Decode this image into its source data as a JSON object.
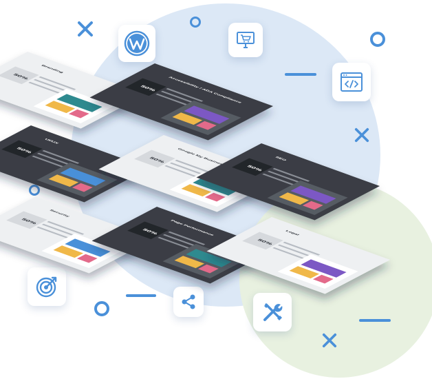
{
  "colors": {
    "accent": "#4a90d9",
    "blob_blue": "#dce8f6",
    "blob_green": "#e8f1e0",
    "dark_slide": "#3a3d44",
    "light_slide": "#eef0f2",
    "teal": "#2d8a8f"
  },
  "icons": [
    "wordpress-icon",
    "cart-monitor-icon",
    "code-window-icon",
    "target-icon",
    "share-icon",
    "tools-icon"
  ],
  "slides": [
    {
      "title": "Branding",
      "percent": "50%",
      "theme": "light"
    },
    {
      "title": "Accessibility / ADA Compliance",
      "percent": "50%",
      "theme": "dark"
    },
    {
      "title": "UI/UX",
      "percent": "50%",
      "theme": "dark"
    },
    {
      "title": "Google My Business (GMB)",
      "percent": "50%",
      "theme": "light"
    },
    {
      "title": "SEO",
      "percent": "50%",
      "theme": "dark"
    },
    {
      "title": "Security",
      "percent": "50%",
      "theme": "light"
    },
    {
      "title": "Page Performance",
      "percent": "50%",
      "theme": "dark"
    },
    {
      "title": "Legal",
      "percent": "50%",
      "theme": "light"
    }
  ]
}
